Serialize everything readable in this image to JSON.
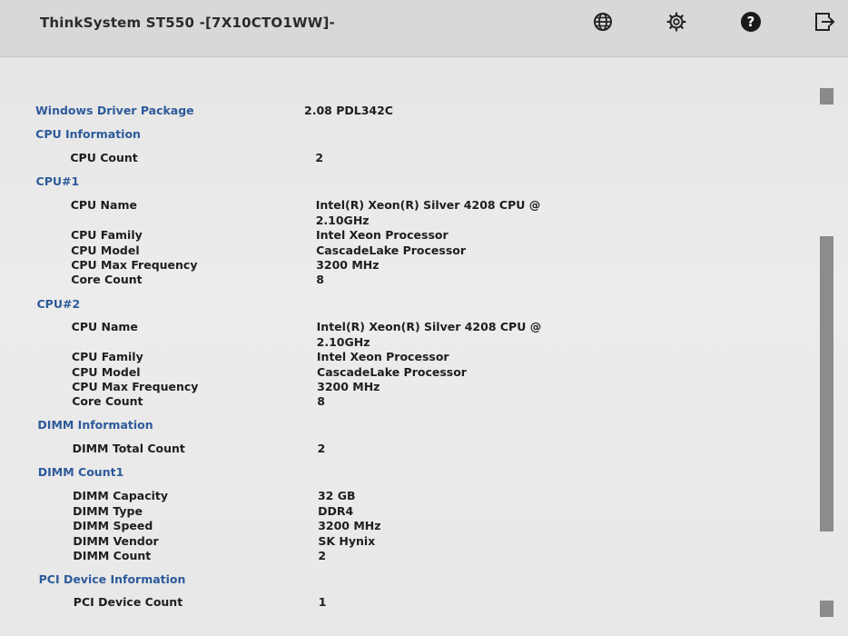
{
  "header": {
    "title": "ThinkSystem ST550 -[7X10CTO1WW]-",
    "icons": [
      "globe-icon",
      "gear-icon",
      "help-icon",
      "exit-icon"
    ]
  },
  "rows": [
    {
      "type": "item",
      "label": "Windows Driver Package",
      "value": "2.08 PDL342C"
    },
    {
      "type": "section",
      "label": "CPU Information"
    },
    {
      "type": "item",
      "label": "CPU Count",
      "value": "2"
    },
    {
      "type": "section",
      "label": "CPU#1"
    },
    {
      "type": "item",
      "label": "CPU Name",
      "value": "Intel(R) Xeon(R) Silver 4208 CPU @",
      "value2": "2.10GHz"
    },
    {
      "type": "item",
      "label": "CPU Family",
      "value": "Intel Xeon Processor"
    },
    {
      "type": "item",
      "label": "CPU Model",
      "value": "CascadeLake Processor"
    },
    {
      "type": "item",
      "label": "CPU Max Frequency",
      "value": "3200 MHz"
    },
    {
      "type": "item",
      "label": "Core Count",
      "value": "8"
    },
    {
      "type": "section",
      "label": "CPU#2"
    },
    {
      "type": "item",
      "label": "CPU Name",
      "value": "Intel(R) Xeon(R) Silver 4208 CPU @",
      "value2": "2.10GHz"
    },
    {
      "type": "item",
      "label": "CPU Family",
      "value": "Intel Xeon Processor"
    },
    {
      "type": "item",
      "label": "CPU Model",
      "value": "CascadeLake Processor"
    },
    {
      "type": "item",
      "label": "CPU Max Frequency",
      "value": "3200 MHz"
    },
    {
      "type": "item",
      "label": "Core Count",
      "value": "8"
    },
    {
      "type": "section",
      "label": "DIMM Information"
    },
    {
      "type": "item",
      "label": "DIMM Total Count",
      "value": "2"
    },
    {
      "type": "section",
      "label": "DIMM Count1"
    },
    {
      "type": "item",
      "label": "DIMM Capacity",
      "value": "32 GB"
    },
    {
      "type": "item",
      "label": "DIMM Type",
      "value": "DDR4"
    },
    {
      "type": "item",
      "label": "DIMM Speed",
      "value": "3200 MHz"
    },
    {
      "type": "item",
      "label": "DIMM Vendor",
      "value": "SK Hynix"
    },
    {
      "type": "item",
      "label": "DIMM Count",
      "value": "2"
    },
    {
      "type": "section",
      "label": "PCI Device Information"
    },
    {
      "type": "item",
      "label": "PCI Device Count",
      "value": "1"
    }
  ]
}
